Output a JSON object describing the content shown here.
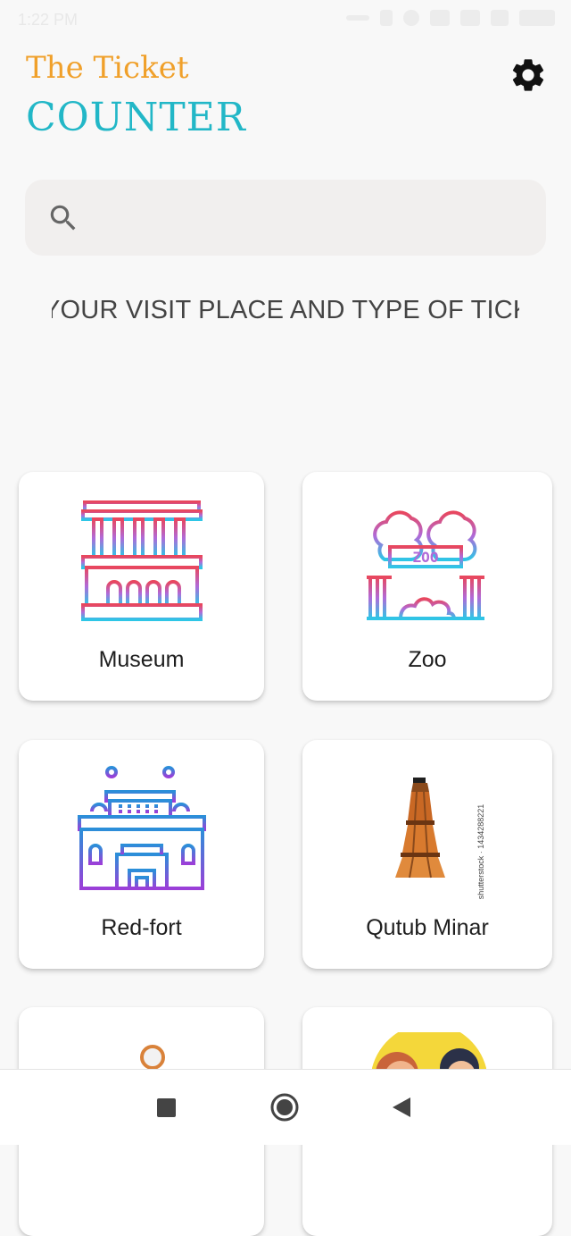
{
  "status_bar": {
    "time": "1:22 PM",
    "icons": [
      "dots-icon",
      "sim-icon",
      "alarm-icon",
      "signal-icon",
      "network-4g-icon",
      "wifi-icon",
      "battery-icon"
    ]
  },
  "header": {
    "title_line1": "The Ticket",
    "title_line2": "COUNTER",
    "settings_icon": "gear-icon",
    "colors": {
      "line1": "#f0a02a",
      "line2": "#22b7c7"
    }
  },
  "search": {
    "placeholder": "",
    "value": ""
  },
  "marquee": {
    "text": "YOUR VISIT PLACE AND TYPE OF TICKET"
  },
  "cards": [
    {
      "label": "Museum",
      "icon": "museum-icon"
    },
    {
      "label": "Zoo",
      "icon": "zoo-icon"
    },
    {
      "label": "Red-fort",
      "icon": "red-fort-icon"
    },
    {
      "label": "Qutub Minar",
      "icon": "qutub-minar-icon",
      "watermark": "shutterstock · 1434288221"
    },
    {
      "label": "",
      "icon": "ring-icon"
    },
    {
      "label": "",
      "icon": "people-icon"
    }
  ],
  "navbar": {
    "items": [
      "recents-button",
      "home-button",
      "back-button"
    ]
  }
}
